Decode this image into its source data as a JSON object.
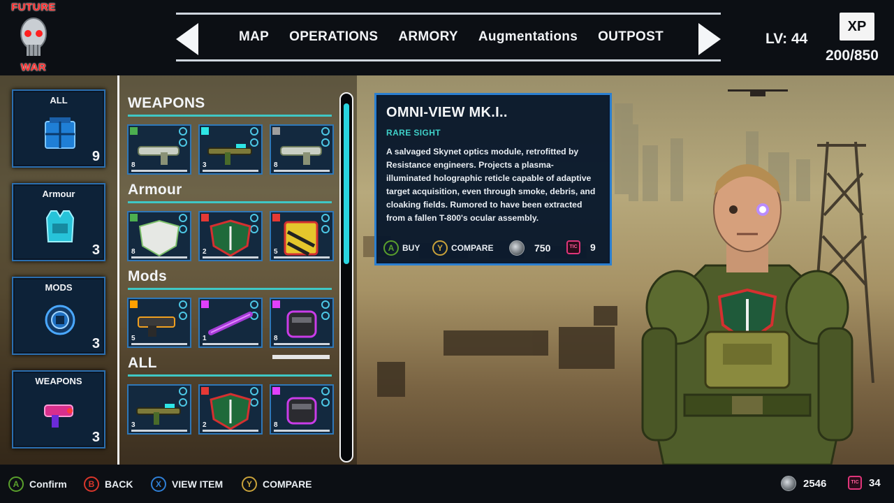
{
  "logo": {
    "line1": "FUTURE",
    "line2": "WAR"
  },
  "nav": {
    "tabs": [
      "MAP",
      "OPERATIONS",
      "ARMORY",
      "Augmentations",
      "OUTPOST"
    ],
    "prev_icon": "arrow-left-icon",
    "next_icon": "arrow-right-icon"
  },
  "player": {
    "level": "LV: 44",
    "xp_label": "XP",
    "xp_value": "200/850"
  },
  "categories": [
    {
      "label": "ALL",
      "count": "9",
      "icon": "crate-icon"
    },
    {
      "label": "Armour",
      "count": "3",
      "icon": "vest-icon"
    },
    {
      "label": "MODS",
      "count": "3",
      "icon": "chip-icon"
    },
    {
      "label": "WEAPONS",
      "count": "3",
      "icon": "blaster-icon"
    }
  ],
  "inventory": {
    "sections": [
      {
        "title": "WEAPONS",
        "items": [
          {
            "count": "8",
            "rarity_color": "#4caf50",
            "icon": "shotgun-icon"
          },
          {
            "count": "3",
            "rarity_color": "#2ee6e6",
            "icon": "rifle-icon"
          },
          {
            "count": "8",
            "rarity_color": "#9e9e9e",
            "icon": "shotgun-icon"
          }
        ]
      },
      {
        "title": "Armour",
        "items": [
          {
            "count": "8",
            "rarity_color": "#4caf50",
            "icon": "shield-icon"
          },
          {
            "count": "2",
            "rarity_color": "#e53935",
            "icon": "emblem-icon"
          },
          {
            "count": "5",
            "rarity_color": "#e53935",
            "icon": "hazard-shield-icon"
          }
        ]
      },
      {
        "title": "Mods",
        "items": [
          {
            "count": "5",
            "rarity_color": "#ffa000",
            "icon": "gun-mod-icon"
          },
          {
            "count": "1",
            "rarity_color": "#e040fb",
            "icon": "barrel-mod-icon"
          },
          {
            "count": "8",
            "rarity_color": "#e040fb",
            "icon": "scope-mod-icon"
          }
        ]
      },
      {
        "title": "ALL",
        "items": [
          {
            "count": "3",
            "rarity_color": "",
            "icon": "rifle-icon"
          },
          {
            "count": "2",
            "rarity_color": "#e53935",
            "icon": "emblem-icon"
          },
          {
            "count": "8",
            "rarity_color": "#e040fb",
            "icon": "scope-mod-icon"
          }
        ]
      }
    ]
  },
  "detail": {
    "name": "OMNI-VIEW MK.I..",
    "rarity": "RARE SIGHT",
    "description": "A salvaged Skynet optics module, retrofitted by Resistance engineers. Projects a plasma-illuminated holographic reticle capable of adaptive target acquisition, even through smoke, debris, and cloaking fields. Rumored to have been extracted from a fallen T-800's ocular assembly.",
    "buy_button": "A",
    "buy_label": "BUY",
    "compare_button": "Y",
    "compare_label": "COMPARE",
    "price_coins": "750",
    "price_tic": "9",
    "tic_label": "TIC"
  },
  "footer": {
    "hints": [
      {
        "button": "A",
        "label": "Confirm",
        "color": "#5aa02c"
      },
      {
        "button": "B",
        "label": "BACK",
        "color": "#d9362b"
      },
      {
        "button": "X",
        "label": "VIEW ITEM",
        "color": "#2f7fd6"
      },
      {
        "button": "Y",
        "label": "COMPARE",
        "color": "#c9a23a"
      }
    ],
    "coins": "2546",
    "tic": "34",
    "tic_label": "TIC"
  },
  "colors": {
    "accent_teal": "#3fc7c5",
    "panel_blue": "#2b7fd0",
    "logo_red": "#ff2a2a"
  }
}
